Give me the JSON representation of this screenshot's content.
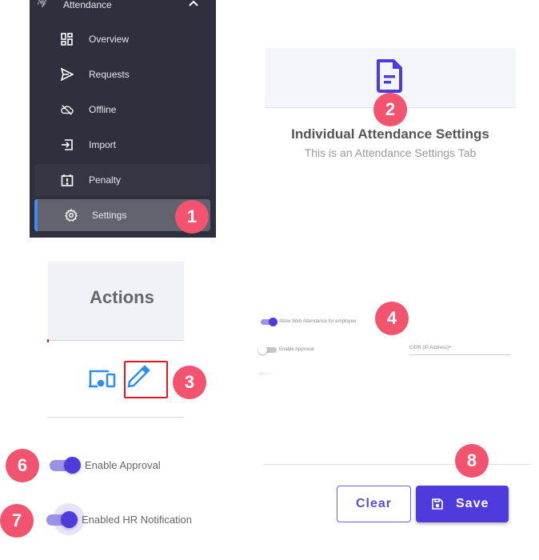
{
  "sidebar": {
    "section": {
      "label": "Attendance",
      "icon": "fingerprint-icon",
      "expanded": true
    },
    "items": [
      {
        "label": "Overview",
        "icon": "dashboard-icon"
      },
      {
        "label": "Requests",
        "icon": "send-icon"
      },
      {
        "label": "Offline",
        "icon": "cloud-off-icon"
      },
      {
        "label": "Import",
        "icon": "import-icon"
      },
      {
        "label": "Penalty",
        "icon": "calendar-alert-icon"
      },
      {
        "label": "Settings",
        "icon": "gear-icon",
        "active": true
      }
    ]
  },
  "badges": {
    "b1": "1",
    "b2": "2",
    "b3": "3",
    "b4": "4",
    "b6": "6",
    "b7": "7",
    "b8": "8"
  },
  "settings_header": {
    "icon": "document-icon",
    "title": "Individual Attendance Settings",
    "subtitle": "This is an Attendance Settings Tab"
  },
  "actions": {
    "header": "Actions",
    "icons": [
      "devices-icon",
      "edit-icon"
    ]
  },
  "form": {
    "allow_web": {
      "label": "Allow Web Attendance for employee",
      "on": true
    },
    "enable_approval": {
      "label": "Enable Approval",
      "on": false
    },
    "cidr": {
      "placeholder": "CIDR (IP Address)+"
    }
  },
  "toggles": {
    "enable_approval": {
      "label": "Enable Approval",
      "on": true
    },
    "hr_notification": {
      "label": "Enabled HR Notification",
      "on": true
    }
  },
  "footer": {
    "clear_label": "Clear",
    "save_label": "Save"
  },
  "colors": {
    "accent": "#4f3bdc",
    "badge": "#f2536e",
    "sidebar_bg": "#2f303d",
    "active_indicator": "#3b8df5",
    "edit_highlight": "#e8141f"
  }
}
